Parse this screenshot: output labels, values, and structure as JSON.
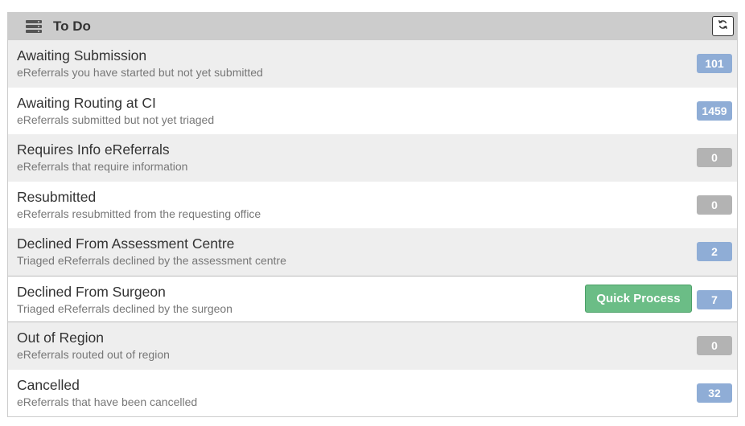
{
  "panel": {
    "title": "To Do",
    "icon": "server-icon",
    "refresh_icon": "refresh-icon"
  },
  "colors": {
    "badge_active": "#8fadd6",
    "badge_zero": "#b3b3b3",
    "quick_process": "#6bbd86"
  },
  "rows": [
    {
      "title": "Awaiting Submission",
      "subtitle": "eReferrals you have started but not yet submitted",
      "count": "101"
    },
    {
      "title": "Awaiting Routing at CI",
      "subtitle": "eReferrals submitted but not yet triaged",
      "count": "1459"
    },
    {
      "title": "Requires Info eReferrals",
      "subtitle": "eReferrals that require information",
      "count": "0"
    },
    {
      "title": "Resubmitted",
      "subtitle": "eReferrals resubmitted from the requesting office",
      "count": "0"
    },
    {
      "title": "Declined From Assessment Centre",
      "subtitle": "Triaged eReferrals declined by the assessment centre",
      "count": "2"
    },
    {
      "title": "Declined From Surgeon",
      "subtitle": "Triaged eReferrals declined by the surgeon",
      "count": "7",
      "action": "Quick Process"
    },
    {
      "title": "Out of Region",
      "subtitle": "eReferrals routed out of region",
      "count": "0"
    },
    {
      "title": "Cancelled",
      "subtitle": "eReferrals that have been cancelled",
      "count": "32"
    }
  ]
}
